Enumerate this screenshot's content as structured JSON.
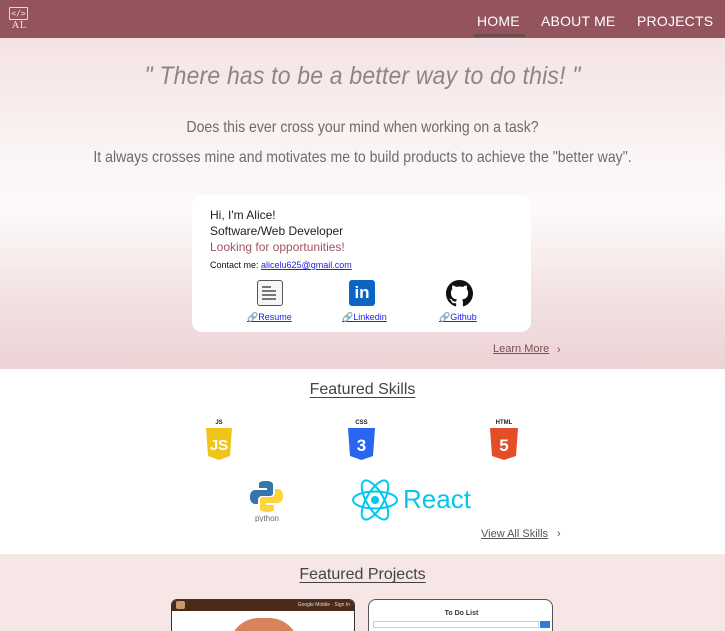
{
  "nav": {
    "logo_text": "AL",
    "logo_code": "</>",
    "items": [
      {
        "label": "HOME"
      },
      {
        "label": "ABOUT ME"
      },
      {
        "label": "PROJECTS"
      }
    ]
  },
  "hero": {
    "quote": "\" There has to be a better way to do this! \"",
    "line1": "Does this ever cross your mind when working on a task?",
    "line2": "It always crosses mine and motivates me to build products to achieve the \"better way\".",
    "card": {
      "greeting": "Hi, I'm Alice!",
      "role": "Software/Web Developer",
      "status": "Looking for opportunities!",
      "contact_label": "Contact me: ",
      "email": "alicelu625@gmail.com",
      "links": [
        {
          "label": "Resume",
          "icon": "resume-icon"
        },
        {
          "label": "Linkedin",
          "icon": "linkedin-icon",
          "icon_text": "in"
        },
        {
          "label": "Github",
          "icon": "github-icon"
        }
      ]
    },
    "learn_more": "Learn More",
    "chevron": "›"
  },
  "skills": {
    "title": "Featured Skills",
    "items": [
      {
        "name": "JS",
        "label": "JS",
        "color": "#f0c419"
      },
      {
        "name": "CSS",
        "label": "CSS",
        "color": "#2965f1"
      },
      {
        "name": "HTML",
        "label": "HTML",
        "color": "#e44d26"
      },
      {
        "name": "python",
        "label": "python",
        "color": "#3776ab"
      },
      {
        "name": "React",
        "label": "React",
        "color": "#00c8f0"
      }
    ],
    "view_all": "View All Skills",
    "chevron": "›"
  },
  "projects": {
    "title": "Featured Projects",
    "cards": [
      {
        "name": "donut-shop",
        "header_text": "Google Mobile · Sign In"
      },
      {
        "name": "todo-list",
        "title": "To Do List"
      }
    ]
  },
  "colors": {
    "nav_bg": "#93545d",
    "accent": "#a05560",
    "link": "#2222ee"
  }
}
